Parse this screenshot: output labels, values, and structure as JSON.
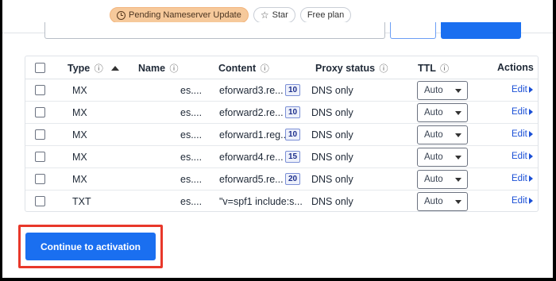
{
  "header": {
    "badges": {
      "pending": "Pending Nameserver Update",
      "star": "Star",
      "plan": "Free plan"
    }
  },
  "table": {
    "columns": {
      "type": "Type",
      "name": "Name",
      "content": "Content",
      "proxy": "Proxy status",
      "ttl": "TTL",
      "actions": "Actions"
    },
    "info_glyph": "ⓘ",
    "rows": [
      {
        "type": "MX",
        "name": "es....",
        "content": "eforward3.re...",
        "priority": "10",
        "proxy": "DNS only",
        "ttl": "Auto",
        "action": "Edit"
      },
      {
        "type": "MX",
        "name": "es....",
        "content": "eforward2.re...",
        "priority": "10",
        "proxy": "DNS only",
        "ttl": "Auto",
        "action": "Edit"
      },
      {
        "type": "MX",
        "name": "es....",
        "content": "eforward1.reg...",
        "priority": "10",
        "proxy": "DNS only",
        "ttl": "Auto",
        "action": "Edit"
      },
      {
        "type": "MX",
        "name": "es....",
        "content": "eforward4.re...",
        "priority": "15",
        "proxy": "DNS only",
        "ttl": "Auto",
        "action": "Edit"
      },
      {
        "type": "MX",
        "name": "es....",
        "content": "eforward5.re...",
        "priority": "20",
        "proxy": "DNS only",
        "ttl": "Auto",
        "action": "Edit"
      },
      {
        "type": "TXT",
        "name": "es....",
        "content": "\"v=spf1 include:s...",
        "priority": "",
        "proxy": "DNS only",
        "ttl": "Auto",
        "action": "Edit"
      }
    ]
  },
  "footer": {
    "continue_label": "Continue to activation"
  },
  "colors": {
    "primary": "#1a6ff0",
    "pending_badge": "#f6c99b",
    "highlight": "#e8382a",
    "link": "#1a4fd6"
  }
}
